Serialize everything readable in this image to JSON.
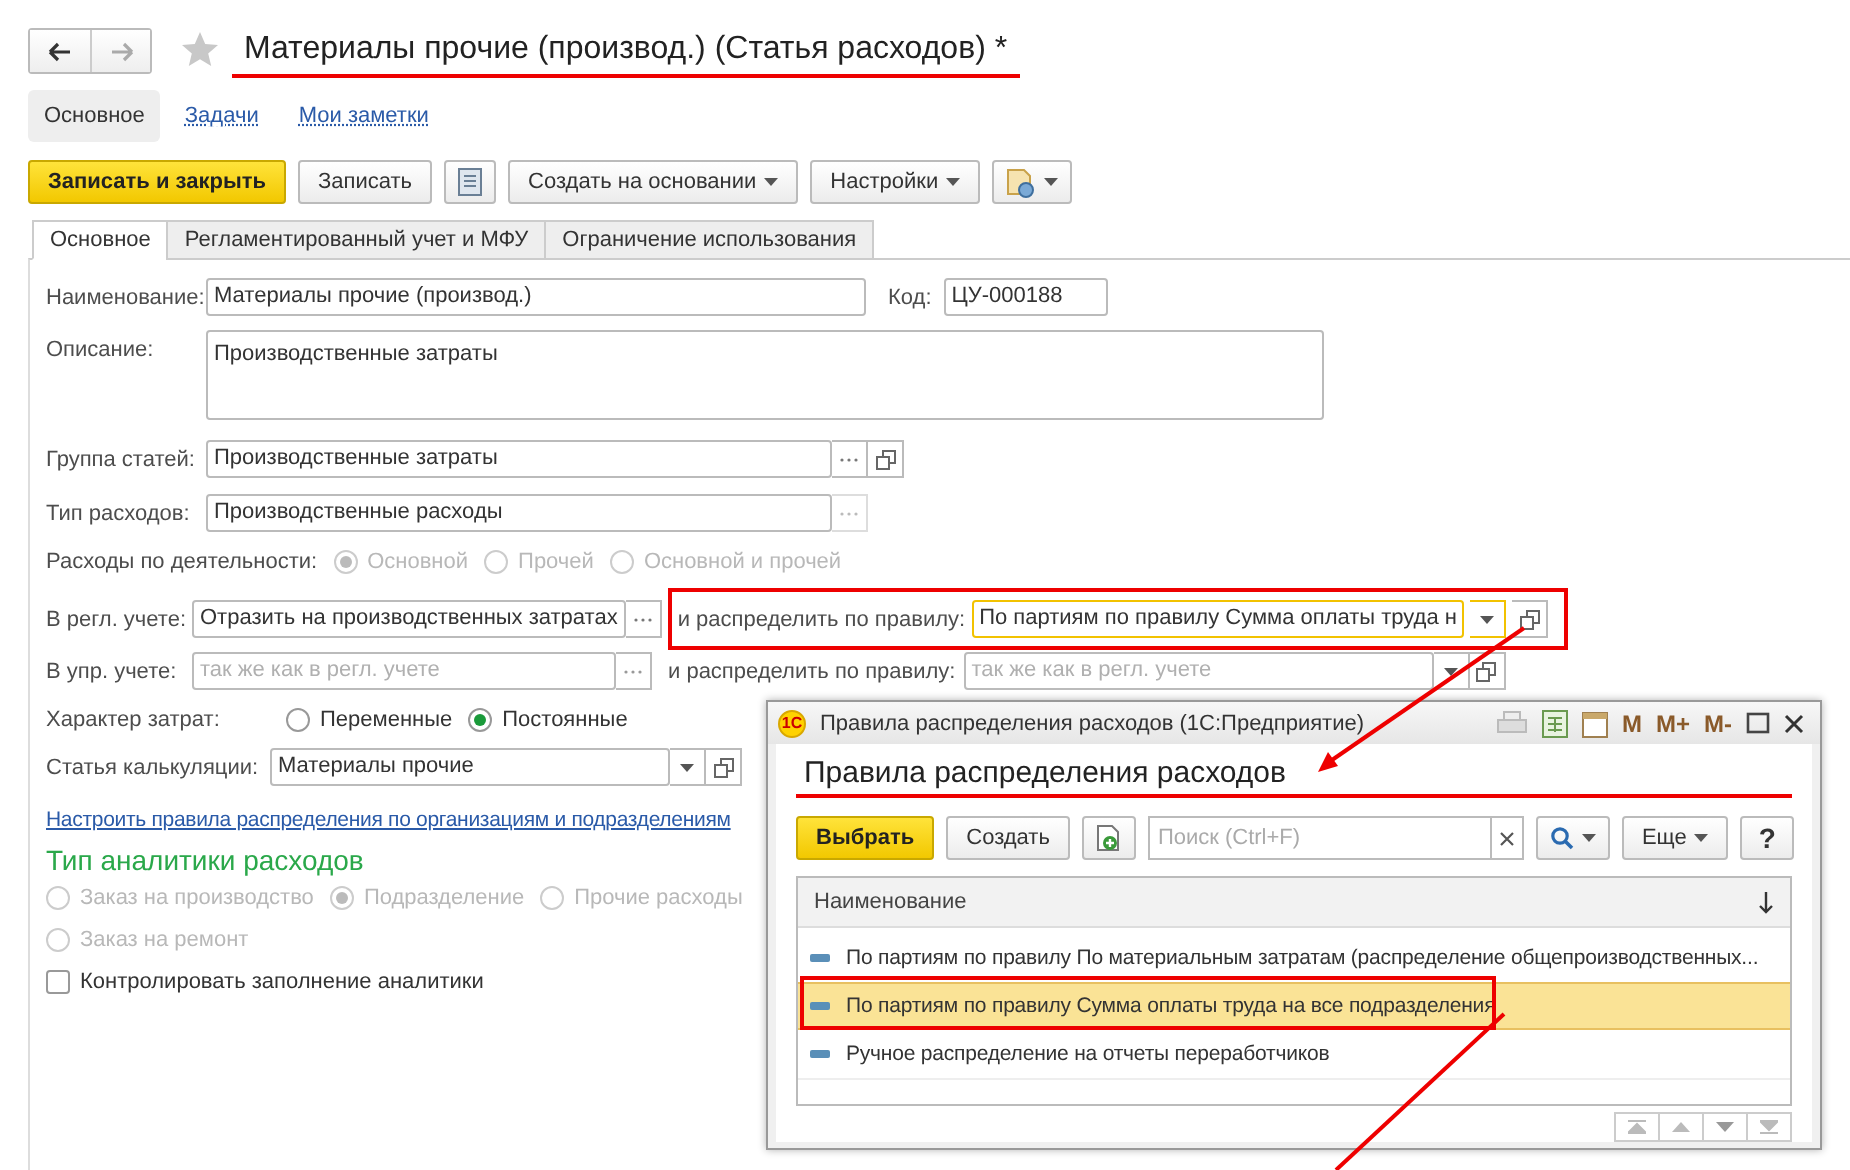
{
  "title": "Материалы прочие (производ.) (Статья расходов) *",
  "favorite": false,
  "nav_tabs": [
    {
      "label": "Основное",
      "selected": true
    },
    {
      "label": "Задачи",
      "selected": false
    },
    {
      "label": "Мои заметки",
      "selected": false
    }
  ],
  "commands": [
    {
      "kind": "primary",
      "label": "Записать и закрыть"
    },
    {
      "kind": "plain",
      "label": "Записать"
    },
    {
      "kind": "list-icon"
    },
    {
      "kind": "dropdown",
      "label": "Создать на основании"
    },
    {
      "kind": "dropdown",
      "label": "Настройки"
    },
    {
      "kind": "report-dropdown"
    }
  ],
  "form_tabs": [
    {
      "label": "Основное",
      "selected": true
    },
    {
      "label": "Регламентированный учет и МФУ",
      "selected": false
    },
    {
      "label": "Ограничение использования",
      "selected": false
    }
  ],
  "name": {
    "label": "Наименование:",
    "value": "Материалы прочие (производ.)"
  },
  "code": {
    "label": "Код:",
    "value": "ЦУ-000188"
  },
  "description": {
    "label": "Описание:",
    "value": "Производственные затраты"
  },
  "group": {
    "label": "Группа статей:",
    "value": "Производственные затраты"
  },
  "expense_type": {
    "label": "Тип расходов:",
    "value": "Производственные расходы"
  },
  "activity": {
    "label": "Расходы по деятельности:",
    "disabled": true,
    "options": [
      {
        "label": "Основной",
        "selected": true
      },
      {
        "label": "Прочей",
        "selected": false
      },
      {
        "label": "Основной и прочей",
        "selected": false
      }
    ]
  },
  "regl": {
    "label": "В регл. учете:",
    "value": "Отразить на производственных затратах",
    "rule_label": "и распределить по правилу:",
    "rule_value": "По партиям по правилу Сумма оплаты труда н",
    "rule_focused": true
  },
  "upr": {
    "label": "В упр. учете:",
    "placeholder": "так же как в регл. учете",
    "rule_label": "и распределить по правилу:",
    "rule_placeholder": "так же как в регл. учете"
  },
  "cost_nature": {
    "label": "Характер затрат:",
    "options": [
      {
        "label": "Переменные",
        "selected": false
      },
      {
        "label": "Постоянные",
        "selected": true
      }
    ]
  },
  "calc_item": {
    "label": "Статья калькуляции:",
    "value": "Материалы прочие"
  },
  "setup_link": "Настроить правила распределения по организациям и подразделениям",
  "analytics": {
    "heading": "Тип аналитики расходов",
    "disabled": true,
    "rows": [
      [
        {
          "label": "Заказ на производство",
          "selected": false
        },
        {
          "label": "Подразделение",
          "selected": true
        },
        {
          "label": "Прочие расходы",
          "selected": false
        }
      ],
      [
        {
          "label": "Заказ на ремонт",
          "selected": false
        }
      ]
    ]
  },
  "control_checkbox": {
    "label": "Контролировать заполнение аналитики",
    "checked": false
  },
  "dialog": {
    "logo": "1С",
    "window_title": "Правила распределения расходов  (1С:Предприятие)",
    "memory_buttons": [
      "M",
      "M+",
      "M-"
    ],
    "heading": "Правила распределения расходов",
    "select_label": "Выбрать",
    "create_label": "Создать",
    "search_placeholder": "Поиск (Ctrl+F)",
    "more_label": "Еще",
    "help_label": "?",
    "column": "Наименование",
    "rows": [
      {
        "name": "По партиям по правилу По материальным затратам (распределение общепроизводственных...",
        "selected": false
      },
      {
        "name": "По партиям по правилу Сумма оплаты труда на все подразделения",
        "selected": true
      },
      {
        "name": "Ручное распределение на отчеты переработчиков",
        "selected": false
      }
    ]
  }
}
